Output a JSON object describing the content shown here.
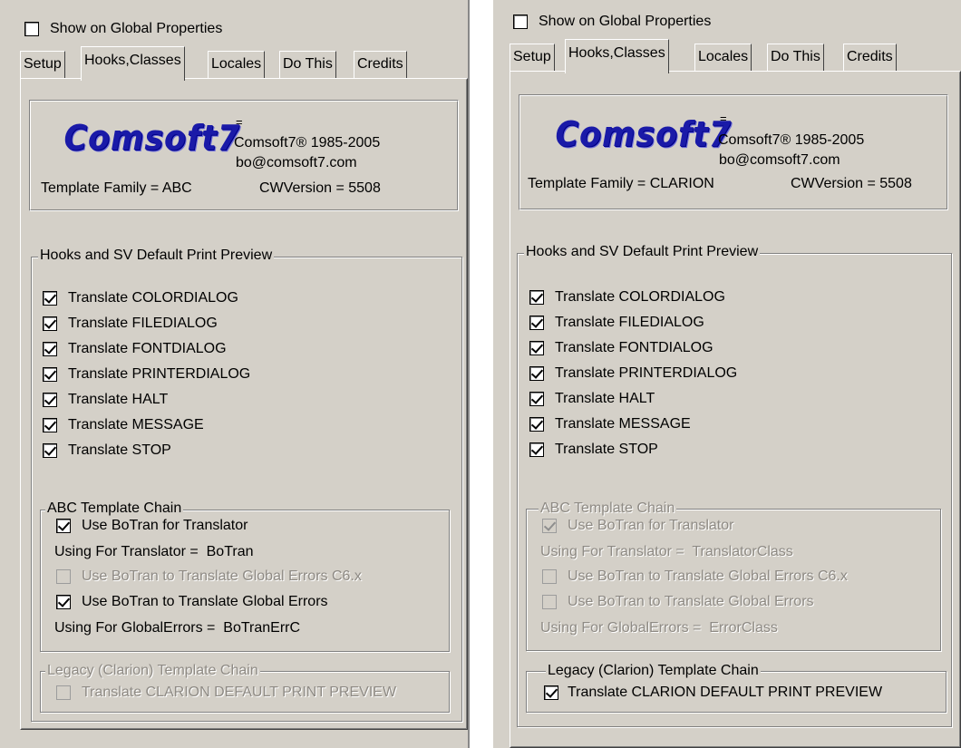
{
  "panels": [
    {
      "show_global": {
        "label": "Show on Global Properties",
        "checked": false
      },
      "tabs": [
        "Setup",
        "Hooks,Classes",
        "Locales",
        "Do This",
        "Credits"
      ],
      "active_tab": "Hooks,Classes",
      "header": {
        "logo": "Comsoft7",
        "equals": "=",
        "copyright": "Comsoft7® 1985-2005",
        "email": "bo@comsoft7.com",
        "template_family": "Template Family = ABC",
        "cw_version": "CWVersion = 5508"
      },
      "hooks_group": {
        "title": "Hooks and SV Default Print Preview",
        "items": [
          "Translate COLORDIALOG",
          "Translate FILEDIALOG",
          "Translate FONTDIALOG",
          "Translate PRINTERDIALOG",
          "Translate HALT",
          "Translate MESSAGE",
          "Translate STOP"
        ]
      },
      "abc_group": {
        "title": "ABC Template Chain",
        "use_botran": "Use BoTran for Translator",
        "using_translator": "Using For Translator =  BoTran",
        "global_errors_c6": "Use BoTran to Translate Global Errors C6.x",
        "global_errors": "Use BoTran to Translate Global Errors",
        "using_global_errors": "Using For GlobalErrors =  BoTranErrC"
      },
      "legacy_group": {
        "title": "Legacy (Clarion) Template Chain",
        "translate_preview": "Translate CLARION DEFAULT PRINT PREVIEW"
      }
    },
    {
      "show_global": {
        "label": "Show on Global Properties",
        "checked": false
      },
      "tabs": [
        "Setup",
        "Hooks,Classes",
        "Locales",
        "Do This",
        "Credits"
      ],
      "active_tab": "Hooks,Classes",
      "header": {
        "logo": "Comsoft7",
        "equals": "=",
        "copyright": "Comsoft7® 1985-2005",
        "email": "bo@comsoft7.com",
        "template_family": "Template Family = CLARION",
        "cw_version": "CWVersion = 5508"
      },
      "hooks_group": {
        "title": "Hooks and SV Default Print Preview",
        "items": [
          "Translate COLORDIALOG",
          "Translate FILEDIALOG",
          "Translate FONTDIALOG",
          "Translate PRINTERDIALOG",
          "Translate HALT",
          "Translate MESSAGE",
          "Translate STOP"
        ]
      },
      "abc_group": {
        "title": "ABC Template Chain",
        "use_botran": "Use BoTran for Translator",
        "using_translator": "Using For Translator =  TranslatorClass",
        "global_errors_c6": "Use BoTran to Translate Global Errors C6.x",
        "global_errors": "Use BoTran to Translate Global Errors",
        "using_global_errors": "Using For GlobalErrors =  ErrorClass"
      },
      "legacy_group": {
        "title": "Legacy (Clarion) Template Chain",
        "translate_preview": "Translate CLARION DEFAULT PRINT PREVIEW"
      }
    }
  ]
}
